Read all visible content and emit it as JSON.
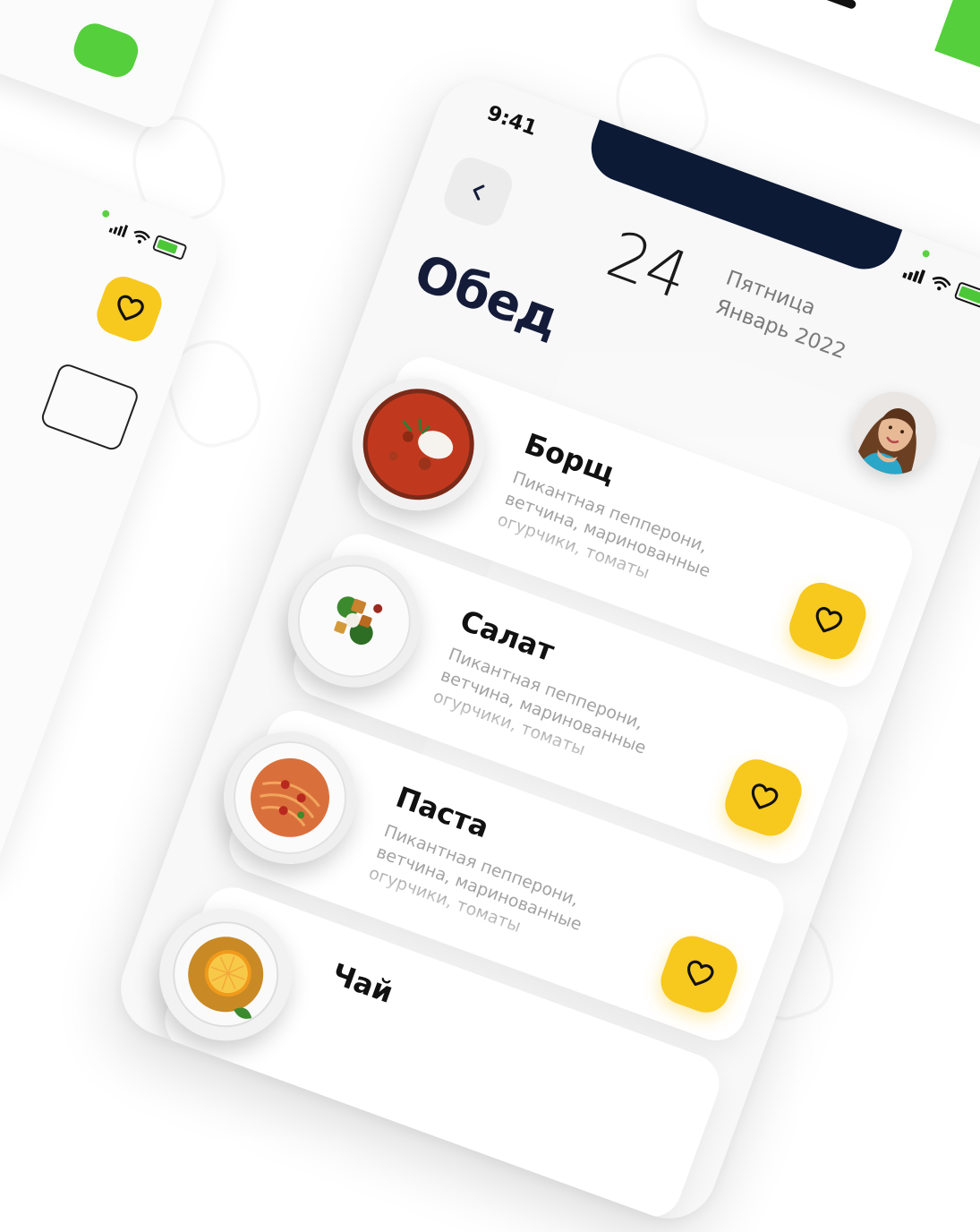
{
  "status_bar": {
    "time": "9:41"
  },
  "header": {
    "date_number": "24",
    "date_weekday": "Пятница",
    "date_month_year": "Январь 2022",
    "title": "Обед"
  },
  "menu": {
    "items": [
      {
        "name": "Борщ",
        "description": "Пикантная пепперони, ветчина, маринованные огурчики, томаты"
      },
      {
        "name": "Салат",
        "description": "Пикантная пепперони, ветчина, маринованные огурчики, томаты"
      },
      {
        "name": "Паста",
        "description": "Пикантная пепперони, ветчина, маринованные огурчики, томаты"
      },
      {
        "name": "Чай"
      }
    ]
  },
  "colors": {
    "accent_yellow": "#f7c81e",
    "title_navy": "#141c3a",
    "notch": "#0c1a36",
    "green": "#55cf3c"
  },
  "icons": {
    "back": "chevron-left-icon",
    "favorite": "heart-icon",
    "signal": "signal-icon",
    "wifi": "wifi-icon",
    "battery": "battery-icon"
  }
}
